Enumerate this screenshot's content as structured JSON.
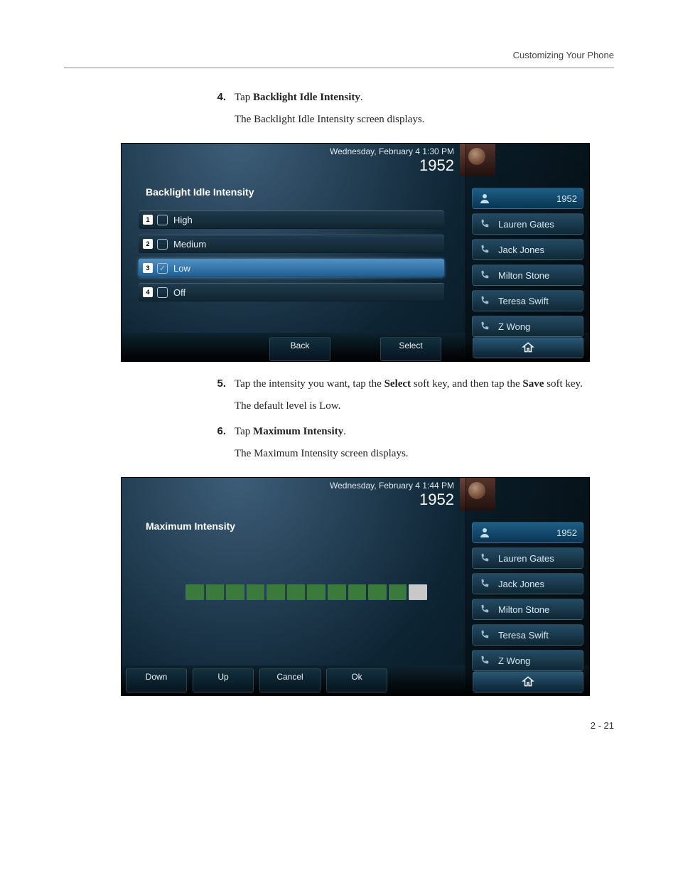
{
  "header": {
    "section": "Customizing Your Phone"
  },
  "steps": {
    "s4": {
      "num": "4.",
      "lead": "Tap ",
      "bold": "Backlight Idle Intensity",
      "tail": "."
    },
    "s4_sub": "The Backlight Idle Intensity screen displays.",
    "s5": {
      "num": "5.",
      "text_a": "Tap the intensity you want, tap the ",
      "b1": "Select",
      "text_b": " soft key, and then tap the ",
      "b2": "Save",
      "text_c": " soft key."
    },
    "s5_sub": "The default level is Low.",
    "s6": {
      "num": "6.",
      "lead": "Tap ",
      "bold": "Maximum Intensity",
      "tail": "."
    },
    "s6_sub": "The Maximum Intensity screen displays."
  },
  "screen1": {
    "datetime": "Wednesday, February 4  1:30 PM",
    "ext": "1952",
    "title": "Backlight Idle Intensity",
    "options": [
      {
        "n": "1",
        "label": "High",
        "checked": false
      },
      {
        "n": "2",
        "label": "Medium",
        "checked": false
      },
      {
        "n": "3",
        "label": "Low",
        "checked": true
      },
      {
        "n": "4",
        "label": "Off",
        "checked": false
      }
    ],
    "softkeys": {
      "back": "Back",
      "select": "Select"
    },
    "side": {
      "ext_label": "1952",
      "contacts": [
        "Lauren Gates",
        "Jack Jones",
        "Milton Stone",
        "Teresa Swift",
        "Z Wong"
      ]
    }
  },
  "screen2": {
    "datetime": "Wednesday, February 4  1:44 PM",
    "ext": "1952",
    "title": "Maximum Intensity",
    "softkeys": {
      "down": "Down",
      "up": "Up",
      "cancel": "Cancel",
      "ok": "Ok"
    },
    "side": {
      "ext_label": "1952",
      "contacts": [
        "Lauren Gates",
        "Jack Jones",
        "Milton Stone",
        "Teresa Swift",
        "Z Wong"
      ]
    }
  },
  "chart_data": {
    "type": "bar",
    "title": "Maximum Intensity",
    "segments_total": 12,
    "segments_filled": 11,
    "value_percent": 92
  },
  "footer": {
    "page": "2 - 21"
  }
}
